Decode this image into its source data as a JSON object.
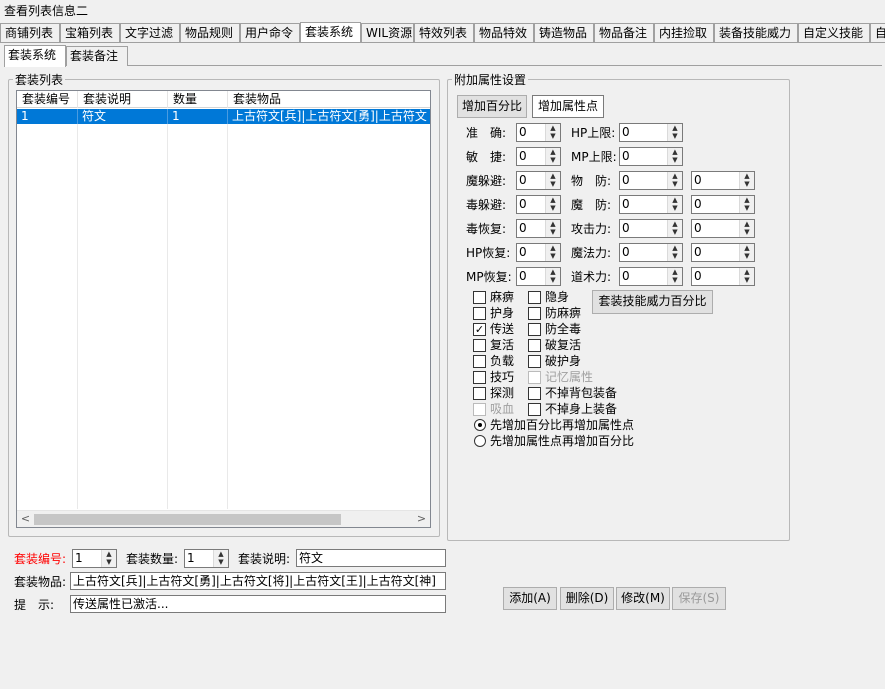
{
  "window": {
    "title": "查看列表信息二"
  },
  "main_tabs": [
    "商铺列表",
    "宝箱列表",
    "文字过滤",
    "物品规则",
    "用户命令",
    "套装系统",
    "WIL资源",
    "特效列表",
    "物品特效",
    "铸造物品",
    "物品备注",
    "内挂捡取",
    "装备技能威力",
    "自定义技能",
    "自"
  ],
  "sub_tabs": [
    "套装系统",
    "套装备注"
  ],
  "suit_list": {
    "legend": "套装列表",
    "columns": [
      "套装编号",
      "套装说明",
      "数量",
      "套装物品"
    ],
    "rows": [
      [
        "1",
        "符文",
        "1",
        "上古符文[兵]|上古符文[勇]|上古符文"
      ]
    ],
    "scroll_left": "<",
    "scroll_right": ">"
  },
  "attr": {
    "legend": "附加属性设置",
    "mode_buttons": [
      "增加百分比",
      "增加属性点"
    ],
    "left_fields": [
      {
        "label": "准　确:",
        "value": "0"
      },
      {
        "label": "敏　捷:",
        "value": "0"
      },
      {
        "label": "魔躲避:",
        "value": "0"
      },
      {
        "label": "毒躲避:",
        "value": "0"
      },
      {
        "label": "毒恢复:",
        "value": "0"
      },
      {
        "label": "HP恢复:",
        "value": "0"
      },
      {
        "label": "MP恢复:",
        "value": "0"
      }
    ],
    "right_fields": [
      {
        "label": "HP上限:",
        "values": [
          "0"
        ]
      },
      {
        "label": "MP上限:",
        "values": [
          "0"
        ]
      },
      {
        "label": "物　防:",
        "values": [
          "0",
          "0"
        ]
      },
      {
        "label": "魔　防:",
        "values": [
          "0",
          "0"
        ]
      },
      {
        "label": "攻击力:",
        "values": [
          "0",
          "0"
        ]
      },
      {
        "label": "魔法力:",
        "values": [
          "0",
          "0"
        ]
      },
      {
        "label": "道术力:",
        "values": [
          "0",
          "0"
        ]
      }
    ],
    "skill_power_button": "套装技能威力百分比",
    "checkboxes_left": [
      {
        "label": "麻痹",
        "checked": false,
        "enabled": true
      },
      {
        "label": "护身",
        "checked": false,
        "enabled": true
      },
      {
        "label": "传送",
        "checked": true,
        "enabled": true
      },
      {
        "label": "复活",
        "checked": false,
        "enabled": true
      },
      {
        "label": "负载",
        "checked": false,
        "enabled": true
      },
      {
        "label": "技巧",
        "checked": false,
        "enabled": true
      },
      {
        "label": "探测",
        "checked": false,
        "enabled": true
      },
      {
        "label": "吸血",
        "checked": false,
        "enabled": false
      }
    ],
    "checkboxes_right": [
      {
        "label": "隐身",
        "checked": false,
        "enabled": true
      },
      {
        "label": "防麻痹",
        "checked": false,
        "enabled": true
      },
      {
        "label": "防全毒",
        "checked": false,
        "enabled": true
      },
      {
        "label": "破复活",
        "checked": false,
        "enabled": true
      },
      {
        "label": "破护身",
        "checked": false,
        "enabled": true
      },
      {
        "label": "记忆属性",
        "checked": false,
        "enabled": false
      },
      {
        "label": "不掉背包装备",
        "checked": false,
        "enabled": true
      },
      {
        "label": "不掉身上装备",
        "checked": false,
        "enabled": true
      }
    ],
    "radios": [
      {
        "label": "先增加百分比再增加属性点",
        "selected": true
      },
      {
        "label": "先增加属性点再增加百分比",
        "selected": false
      }
    ]
  },
  "form": {
    "id_label": "套装编号:",
    "id_value": "1",
    "count_label": "套装数量:",
    "count_value": "1",
    "desc_label": "套装说明:",
    "desc_value": "符文",
    "items_label": "套装物品:",
    "items_value": "上古符文[兵]|上古符文[勇]|上古符文[将]|上古符文[王]|上古符文[神]",
    "hint_label": "提　示:",
    "hint_value": "传送属性已激活..."
  },
  "actions": {
    "add": "添加(A)",
    "delete": "删除(D)",
    "modify": "修改(M)",
    "save": "保存(S)"
  },
  "colors": {
    "selection": "#0078d7",
    "required_label": "#ff0000",
    "background": "#f0f0f0"
  }
}
